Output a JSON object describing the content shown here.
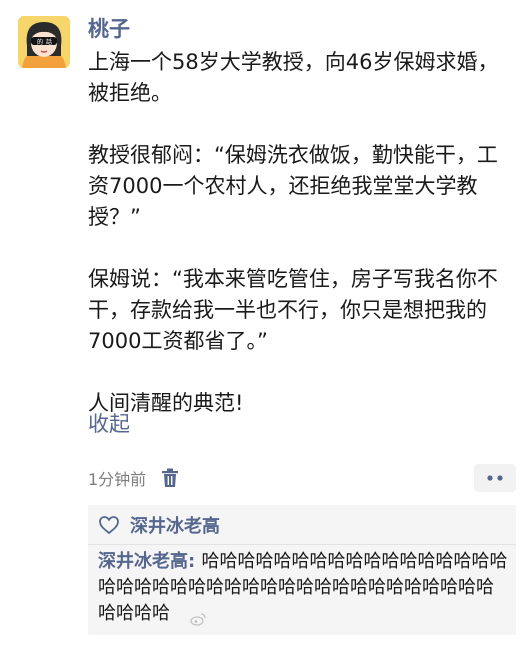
{
  "post": {
    "username": "桃子",
    "paragraphs": [
      "上海一个58岁大学教授，向46岁保姆求婚，被拒绝。",
      "教授很郁闷：“保姆洗衣做饭，勤快能干，工资7000一个农村人，还拒绝我堂堂大学教授？”",
      "保姆说：“我本来管吃管住，房子写我名你不干，存款给我一半也不行，你只是想把我的7000工资都省了。”",
      "人间清醒的典范!"
    ],
    "collapse_label": "收起",
    "timestamp": "1分钟前",
    "icons": {
      "delete": "trash-icon",
      "more": "more-dots-icon",
      "like": "heart-icon"
    }
  },
  "interactions": {
    "likes": [
      "深井冰老高"
    ],
    "comments": [
      {
        "author": "深井冰老高",
        "separator": ": ",
        "text": "哈哈哈哈哈哈哈哈哈哈哈哈哈哈哈哈哈哈哈哈哈哈哈哈哈哈哈哈哈哈哈哈哈哈哈哈哈哈哈哈哈哈哈"
      }
    ]
  },
  "colors": {
    "link": "#56678f",
    "text": "#1a1a1a",
    "meta": "#7f7f7f",
    "panel": "#f5f5f5"
  }
}
